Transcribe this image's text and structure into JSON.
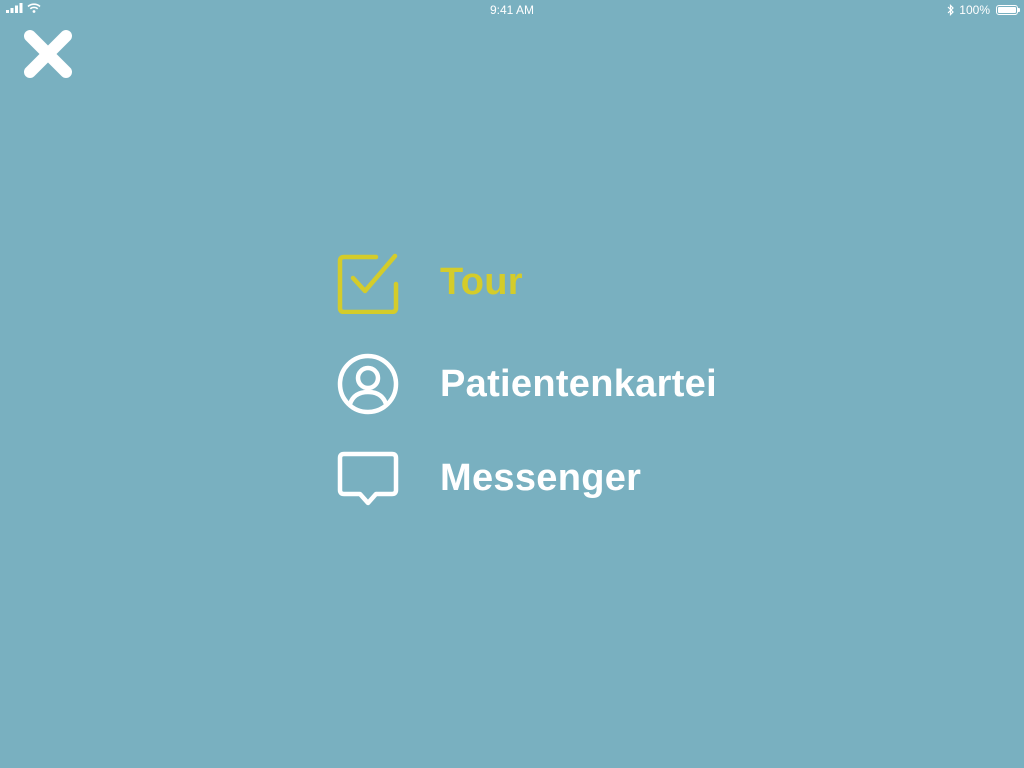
{
  "status_bar": {
    "time": "9:41 AM",
    "battery_percent": "100%",
    "icons": [
      "signal-icon",
      "wifi-icon",
      "bluetooth-icon",
      "battery-icon"
    ]
  },
  "colors": {
    "background": "#79b0c0",
    "active": "#d4cc2a",
    "inactive": "#ffffff"
  },
  "close_button": {
    "icon": "close-icon"
  },
  "menu": {
    "items": [
      {
        "label": "Tour",
        "icon": "checkbox-icon",
        "active": true
      },
      {
        "label": "Patientenkartei",
        "icon": "user-circle-icon",
        "active": false
      },
      {
        "label": "Messenger",
        "icon": "chat-bubble-icon",
        "active": false
      }
    ]
  }
}
